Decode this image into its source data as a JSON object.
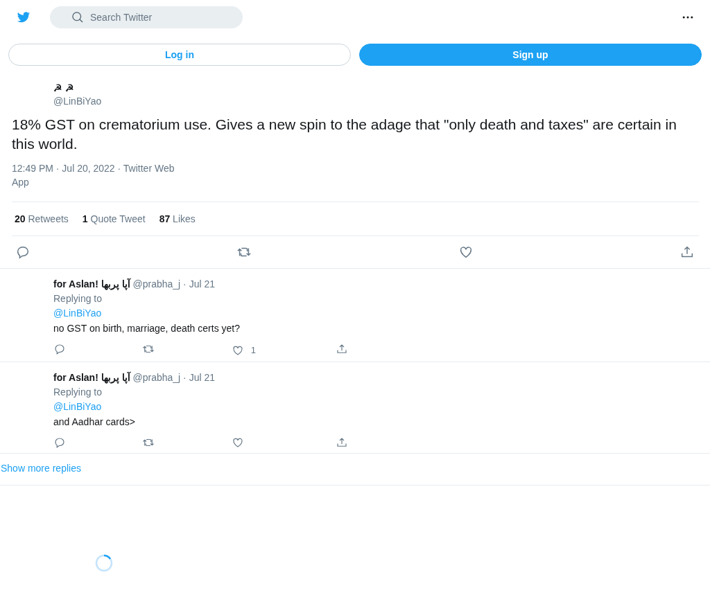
{
  "header": {
    "search": {
      "placeholder": "Search Twitter"
    }
  },
  "auth": {
    "login": "Log in",
    "signup": "Sign up"
  },
  "tweet": {
    "name": "☭ ☭",
    "handle": "@LinBiYao",
    "text": "18% GST on crematorium use. Gives a new spin to the adage that \"only death and taxes\" are certain in this world.",
    "time": "12:49 PM · Jul 20, 2022 · Twitter Web",
    "source": "App",
    "stats": [
      {
        "count": "20",
        "label": "Retweets"
      },
      {
        "count": "1",
        "label": "Quote Tweet"
      },
      {
        "count": "87",
        "label": "Likes"
      }
    ]
  },
  "replies": [
    {
      "name": "for Aslan! آپا پربها",
      "handle": "@prabha_j",
      "date": "· Jul 21",
      "replying": "Replying to",
      "mention": "@LinBiYao",
      "text": "no GST on birth, marriage, death certs yet?",
      "likes": "1"
    },
    {
      "name": "for Aslan! آپا پربها",
      "handle": "@prabha_j",
      "date": "· Jul 21",
      "replying": "Replying to",
      "mention": "@LinBiYao",
      "text": "and Aadhar cards>"
    }
  ],
  "show_more": "Show more replies"
}
